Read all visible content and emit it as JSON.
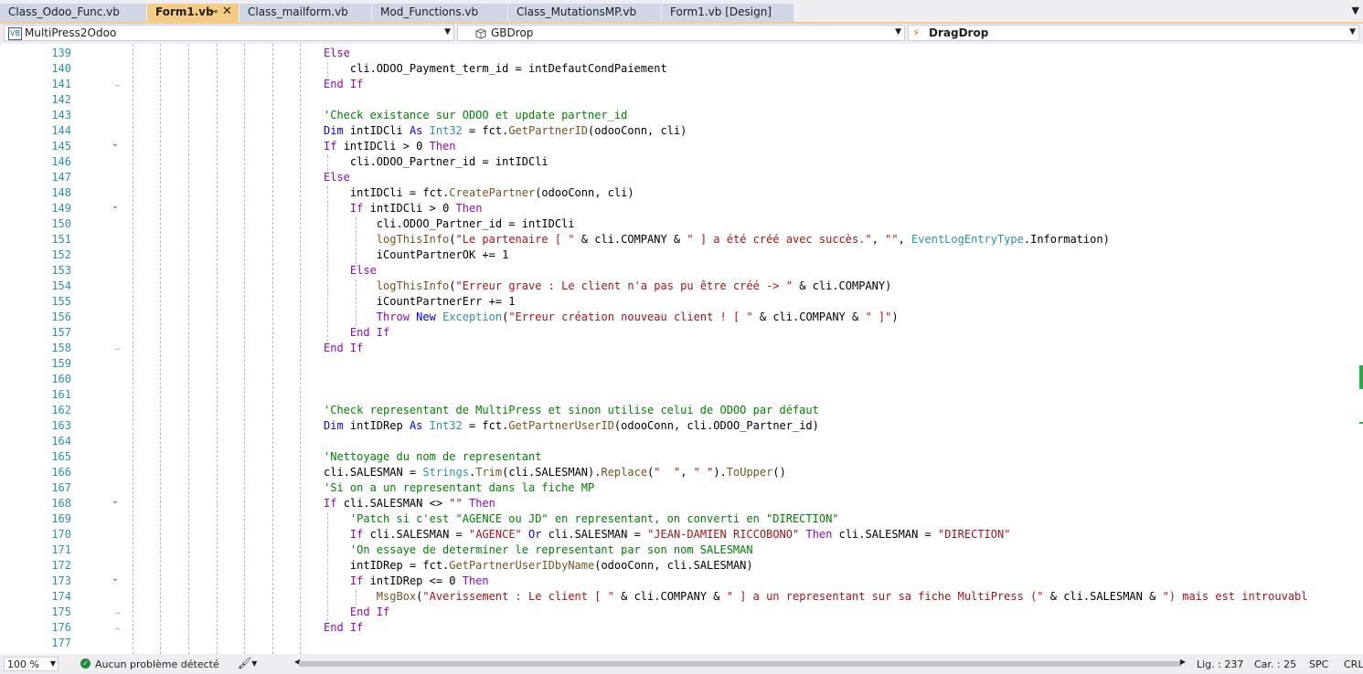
{
  "tabs": [
    {
      "label": "Class_Odoo_Func.vb",
      "active": false
    },
    {
      "label": "Form1.vb",
      "active": true
    },
    {
      "label": "Class_mailform.vb",
      "active": false
    },
    {
      "label": "Mod_Functions.vb",
      "active": false
    },
    {
      "label": "Class_MutationsMP.vb",
      "active": false
    },
    {
      "label": "Form1.vb [Design]",
      "active": false
    }
  ],
  "nav": {
    "project_icon": "VB",
    "project": "MultiPress2Odoo",
    "object": "GBDrop",
    "member": "DragDrop"
  },
  "editor": {
    "line_numbers": [
      "139",
      "140",
      "141",
      "142",
      "143",
      "144",
      "145",
      "146",
      "147",
      "148",
      "149",
      "150",
      "151",
      "152",
      "153",
      "154",
      "155",
      "156",
      "157",
      "158",
      "159",
      "160",
      "161",
      "162",
      "163",
      "164",
      "165",
      "166",
      "167",
      "168",
      "169",
      "170",
      "171",
      "172",
      "173",
      "174",
      "175",
      "176",
      "177"
    ],
    "lines": [
      [
        {
          "t": "Else",
          "c": "kwp"
        }
      ],
      [
        {
          "t": "    cli.ODOO_Payment_term_id = intDefautCondPaiement",
          "c": "nm"
        }
      ],
      [
        {
          "t": "End If",
          "c": "kwp"
        }
      ],
      [],
      [
        {
          "t": "'Check existance sur ODOO et update partner_id",
          "c": "cm"
        }
      ],
      [
        {
          "t": "Dim ",
          "c": "kw"
        },
        {
          "t": "intIDCli ",
          "c": "nm"
        },
        {
          "t": "As ",
          "c": "kw"
        },
        {
          "t": "Int32",
          "c": "ty"
        },
        {
          "t": " = fct.",
          "c": "nm"
        },
        {
          "t": "GetPartnerID",
          "c": "mt"
        },
        {
          "t": "(odooConn, cli)",
          "c": "nm"
        }
      ],
      [
        {
          "t": "If ",
          "c": "kwp"
        },
        {
          "t": "intIDCli > 0 ",
          "c": "nm"
        },
        {
          "t": "Then",
          "c": "kwp"
        }
      ],
      [
        {
          "t": "    cli.ODOO_Partner_id = intIDCli",
          "c": "nm"
        }
      ],
      [
        {
          "t": "Else",
          "c": "kwp"
        }
      ],
      [
        {
          "t": "    intIDCli = fct.",
          "c": "nm"
        },
        {
          "t": "CreatePartner",
          "c": "mt"
        },
        {
          "t": "(odooConn, cli)",
          "c": "nm"
        }
      ],
      [
        {
          "t": "    ",
          "c": "nm"
        },
        {
          "t": "If ",
          "c": "kwp"
        },
        {
          "t": "intIDCli > 0 ",
          "c": "nm"
        },
        {
          "t": "Then",
          "c": "kwp"
        }
      ],
      [
        {
          "t": "        cli.ODOO_Partner_id = intIDCli",
          "c": "nm"
        }
      ],
      [
        {
          "t": "        ",
          "c": "nm"
        },
        {
          "t": "logThisInfo",
          "c": "mt"
        },
        {
          "t": "(",
          "c": "nm"
        },
        {
          "t": "\"Le partenaire [ \"",
          "c": "str"
        },
        {
          "t": " & cli.COMPANY & ",
          "c": "nm"
        },
        {
          "t": "\" ] a été créé avec succès.\"",
          "c": "str"
        },
        {
          "t": ", ",
          "c": "nm"
        },
        {
          "t": "\"\"",
          "c": "str"
        },
        {
          "t": ", ",
          "c": "nm"
        },
        {
          "t": "EventLogEntryType",
          "c": "ty"
        },
        {
          "t": ".Information)",
          "c": "nm"
        }
      ],
      [
        {
          "t": "        iCountPartnerOK += 1",
          "c": "nm"
        }
      ],
      [
        {
          "t": "    ",
          "c": "nm"
        },
        {
          "t": "Else",
          "c": "kwp"
        }
      ],
      [
        {
          "t": "        ",
          "c": "nm"
        },
        {
          "t": "logThisInfo",
          "c": "mt"
        },
        {
          "t": "(",
          "c": "nm"
        },
        {
          "t": "\"Erreur grave : Le client n'a pas pu être créé -> \"",
          "c": "str"
        },
        {
          "t": " & cli.COMPANY)",
          "c": "nm"
        }
      ],
      [
        {
          "t": "        iCountPartnerErr += 1",
          "c": "nm"
        }
      ],
      [
        {
          "t": "        ",
          "c": "nm"
        },
        {
          "t": "Throw ",
          "c": "kwp"
        },
        {
          "t": "New ",
          "c": "kw"
        },
        {
          "t": "Exception",
          "c": "ty"
        },
        {
          "t": "(",
          "c": "nm"
        },
        {
          "t": "\"Erreur création nouveau client ! [ \"",
          "c": "str"
        },
        {
          "t": " & cli.COMPANY & ",
          "c": "nm"
        },
        {
          "t": "\" ]\"",
          "c": "str"
        },
        {
          "t": ")",
          "c": "nm"
        }
      ],
      [
        {
          "t": "    ",
          "c": "nm"
        },
        {
          "t": "End If",
          "c": "kwp"
        }
      ],
      [
        {
          "t": "End If",
          "c": "kwp"
        }
      ],
      [],
      [],
      [],
      [
        {
          "t": "'Check representant de MultiPress et sinon utilise celui de ODOO par défaut",
          "c": "cm"
        }
      ],
      [
        {
          "t": "Dim ",
          "c": "kw"
        },
        {
          "t": "intIDRep ",
          "c": "nm"
        },
        {
          "t": "As ",
          "c": "kw"
        },
        {
          "t": "Int32",
          "c": "ty"
        },
        {
          "t": " = fct.",
          "c": "nm"
        },
        {
          "t": "GetPartnerUserID",
          "c": "mt"
        },
        {
          "t": "(odooConn, cli.ODOO_Partner_id)",
          "c": "nm"
        }
      ],
      [],
      [
        {
          "t": "'Nettoyage du nom de representant",
          "c": "cm"
        }
      ],
      [
        {
          "t": "cli.SALESMAN = ",
          "c": "nm"
        },
        {
          "t": "Strings",
          "c": "ty"
        },
        {
          "t": ".",
          "c": "nm"
        },
        {
          "t": "Trim",
          "c": "mt"
        },
        {
          "t": "(cli.SALESMAN).",
          "c": "nm"
        },
        {
          "t": "Replace",
          "c": "mt"
        },
        {
          "t": "(",
          "c": "nm"
        },
        {
          "t": "\"  \"",
          "c": "str"
        },
        {
          "t": ", ",
          "c": "nm"
        },
        {
          "t": "\" \"",
          "c": "str"
        },
        {
          "t": ").",
          "c": "nm"
        },
        {
          "t": "ToUpper",
          "c": "mt"
        },
        {
          "t": "()",
          "c": "nm"
        }
      ],
      [
        {
          "t": "'Si on a un representant dans la fiche MP",
          "c": "cm"
        }
      ],
      [
        {
          "t": "If ",
          "c": "kwp"
        },
        {
          "t": "cli.SALESMAN <> ",
          "c": "nm"
        },
        {
          "t": "\"\"",
          "c": "str"
        },
        {
          "t": " ",
          "c": "nm"
        },
        {
          "t": "Then",
          "c": "kwp"
        }
      ],
      [
        {
          "t": "    'Patch si c'est \"AGENCE ou JD\" en representant, on converti en \"DIRECTION\"",
          "c": "cm"
        }
      ],
      [
        {
          "t": "    ",
          "c": "nm"
        },
        {
          "t": "If ",
          "c": "kwp"
        },
        {
          "t": "cli.SALESMAN = ",
          "c": "nm"
        },
        {
          "t": "\"AGENCE\"",
          "c": "str"
        },
        {
          "t": " ",
          "c": "nm"
        },
        {
          "t": "Or ",
          "c": "kw"
        },
        {
          "t": "cli.SALESMAN = ",
          "c": "nm"
        },
        {
          "t": "\"JEAN-DAMIEN RICCOBONO\"",
          "c": "str"
        },
        {
          "t": " ",
          "c": "nm"
        },
        {
          "t": "Then ",
          "c": "kwp"
        },
        {
          "t": "cli.SALESMAN = ",
          "c": "nm"
        },
        {
          "t": "\"DIRECTION\"",
          "c": "str"
        }
      ],
      [
        {
          "t": "    'On essaye de determiner le representant par son nom SALESMAN",
          "c": "cm"
        }
      ],
      [
        {
          "t": "    intIDRep = fct.",
          "c": "nm"
        },
        {
          "t": "GetPartnerUserIDbyName",
          "c": "mt"
        },
        {
          "t": "(odooConn, cli.SALESMAN)",
          "c": "nm"
        }
      ],
      [
        {
          "t": "    ",
          "c": "nm"
        },
        {
          "t": "If ",
          "c": "kwp"
        },
        {
          "t": "intIDRep <= 0 ",
          "c": "nm"
        },
        {
          "t": "Then",
          "c": "kwp"
        }
      ],
      [
        {
          "t": "        ",
          "c": "nm"
        },
        {
          "t": "MsgBox",
          "c": "mt"
        },
        {
          "t": "(",
          "c": "nm"
        },
        {
          "t": "\"Averissement : Le client [ \"",
          "c": "str"
        },
        {
          "t": " & cli.COMPANY & ",
          "c": "nm"
        },
        {
          "t": "\" ] a un representant sur sa fiche MultiPress (\"",
          "c": "str"
        },
        {
          "t": " & cli.SALESMAN & ",
          "c": "nm"
        },
        {
          "t": "\") mais est introuvabl",
          "c": "str"
        }
      ],
      [
        {
          "t": "    ",
          "c": "nm"
        },
        {
          "t": "End If",
          "c": "kwp"
        }
      ],
      [
        {
          "t": "End If",
          "c": "kwp"
        }
      ],
      []
    ]
  },
  "status": {
    "zoom": "100 %",
    "issues": "Aucun problème détecté",
    "line": "Lig. : 237",
    "col": "Car. : 25",
    "spacing": "SPC",
    "line_ending": "CRLF"
  },
  "colors": {
    "tab_active": "#f5cc84",
    "tab_inactive": "#cfd6e5",
    "keyword": "#0000ff",
    "control_keyword": "#8f08c4",
    "string": "#a31515",
    "comment": "#008000",
    "type": "#2b91af",
    "method": "#74531f",
    "line_number": "#2b91af"
  }
}
